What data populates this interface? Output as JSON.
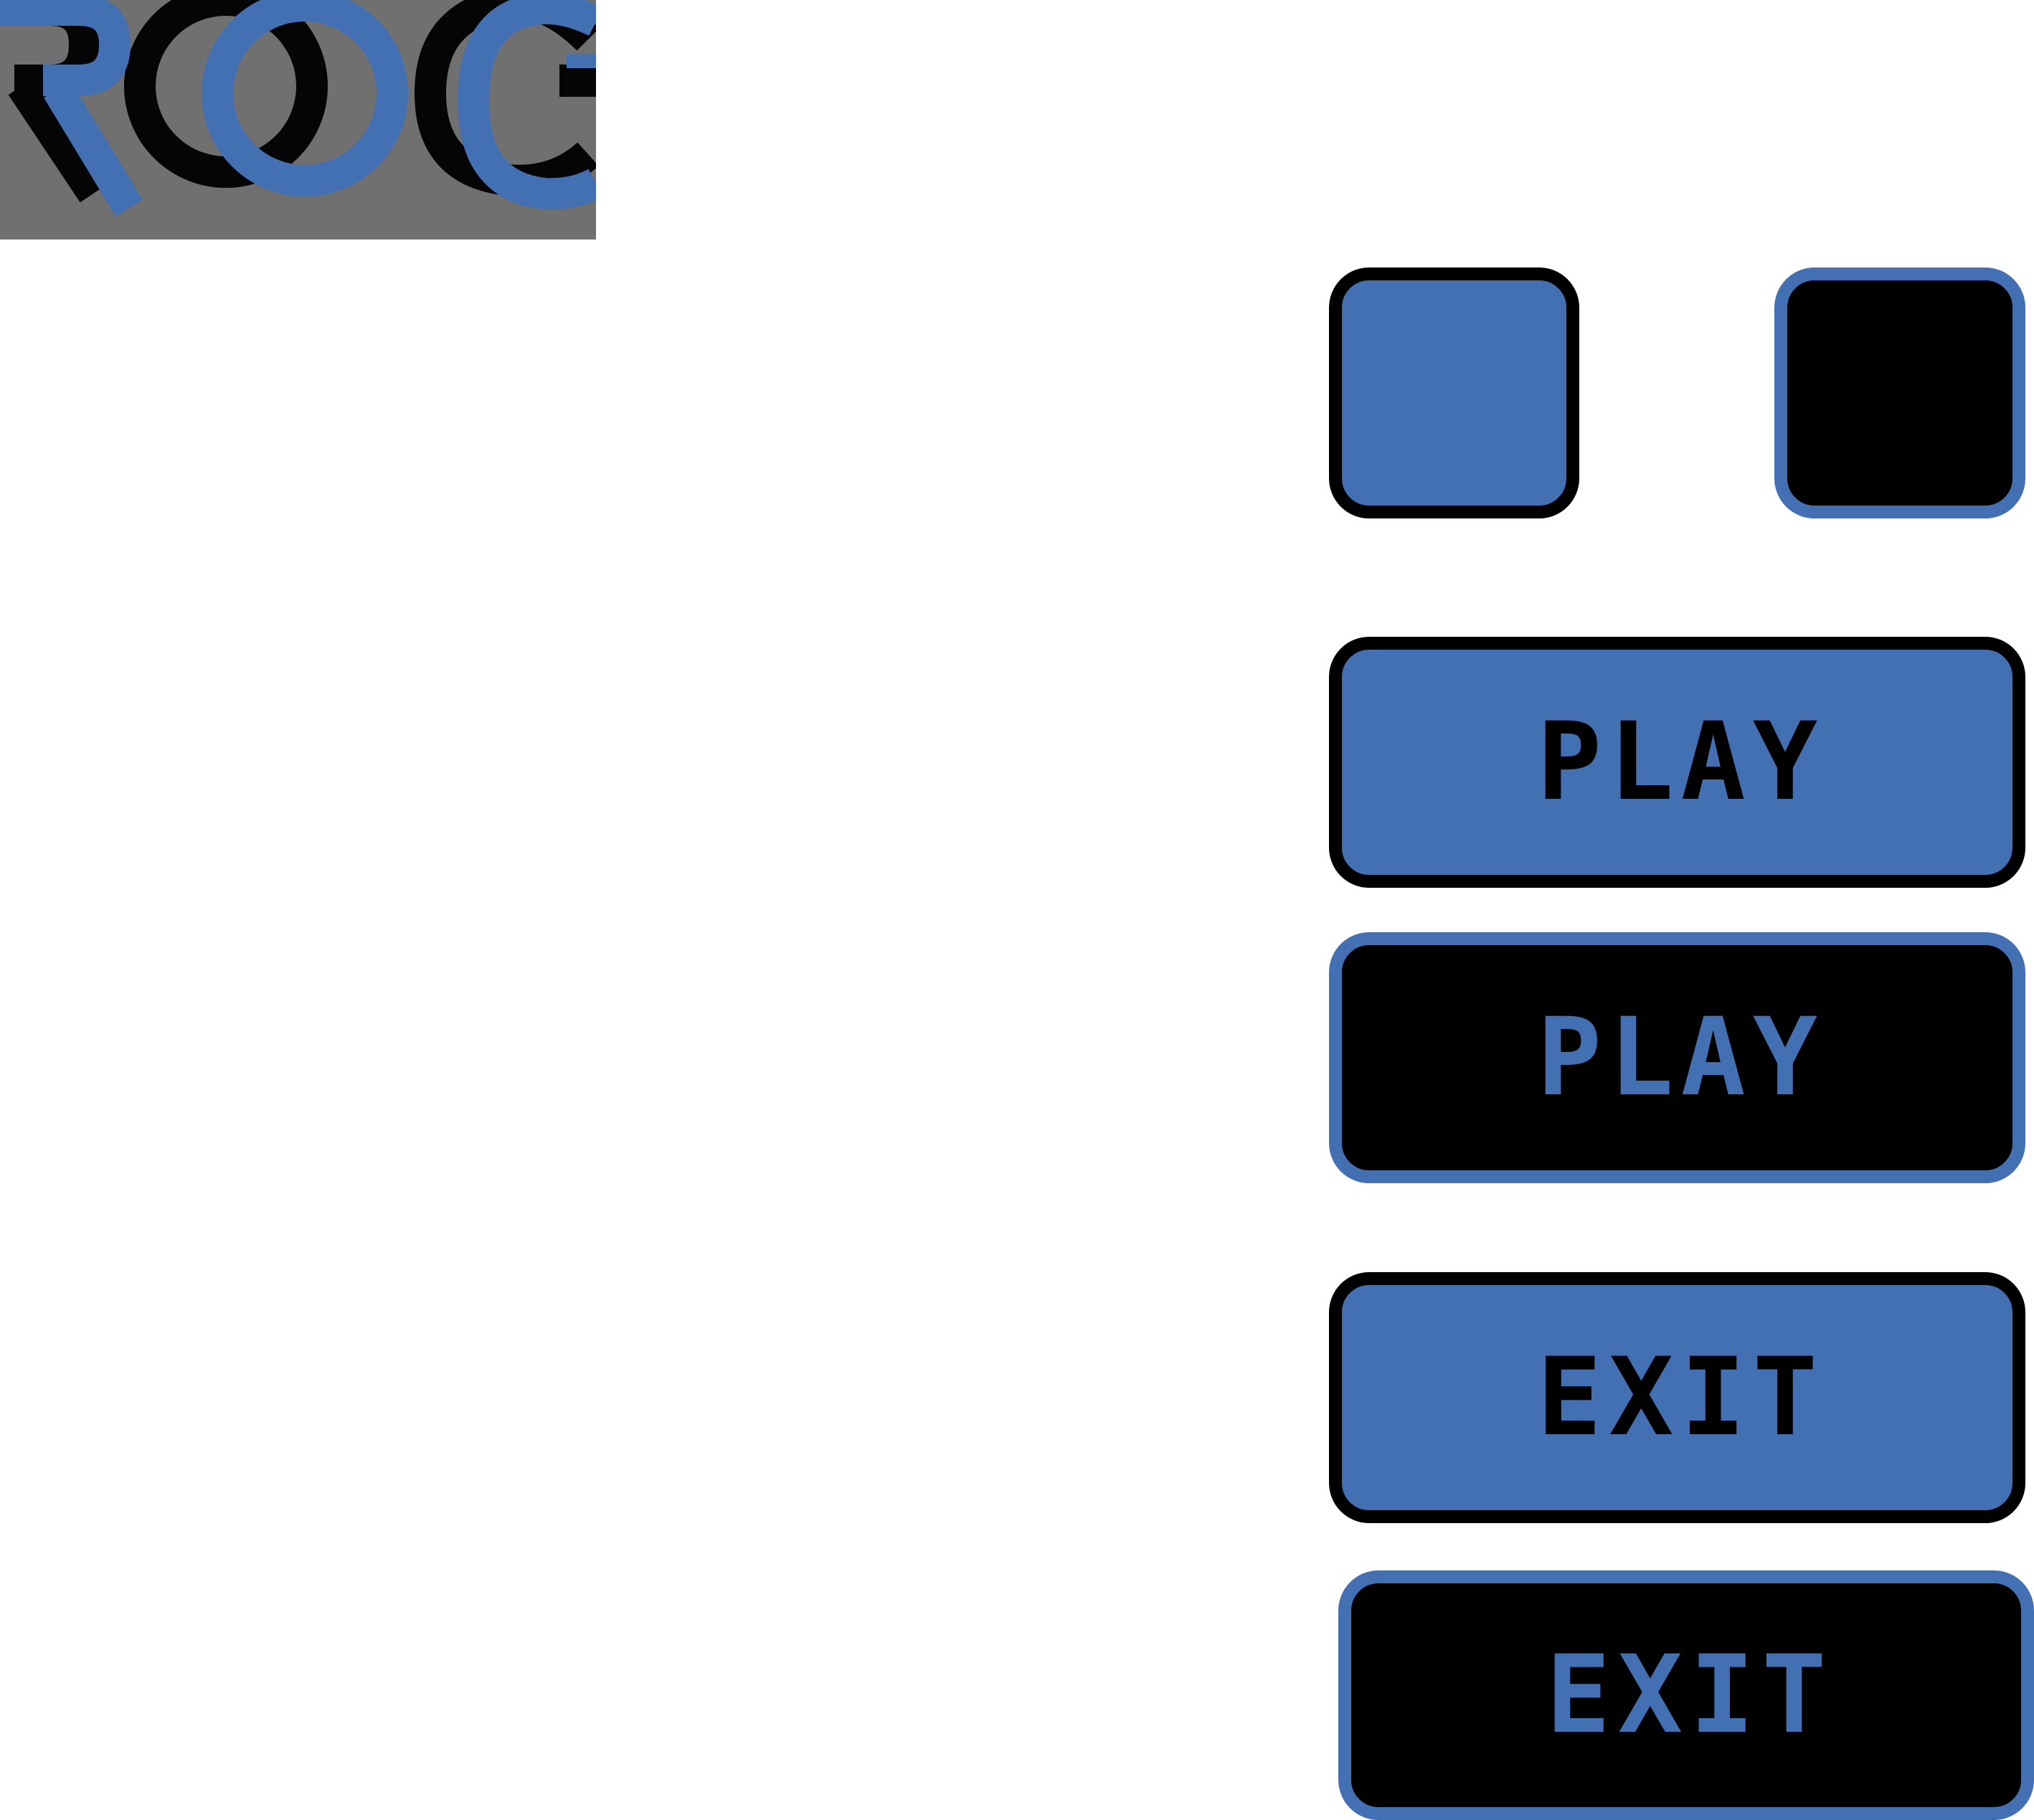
{
  "theme": {
    "blue": "#4370b3",
    "black": "#000000",
    "logo_bg": "#707070"
  },
  "logo": {
    "text": "ROG"
  },
  "square_buttons": [
    {
      "style": "blue-fill-black-border"
    },
    {
      "style": "black-fill-blue-border"
    }
  ],
  "buttons": {
    "play_normal": {
      "label": "PLAY",
      "style": "blue-fill-black-border"
    },
    "play_hover": {
      "label": "PLAY",
      "style": "black-fill-blue-border"
    },
    "exit_normal": {
      "label": "EXIT",
      "style": "blue-fill-black-border"
    },
    "exit_hover": {
      "label": "EXIT",
      "style": "black-fill-blue-border"
    }
  }
}
